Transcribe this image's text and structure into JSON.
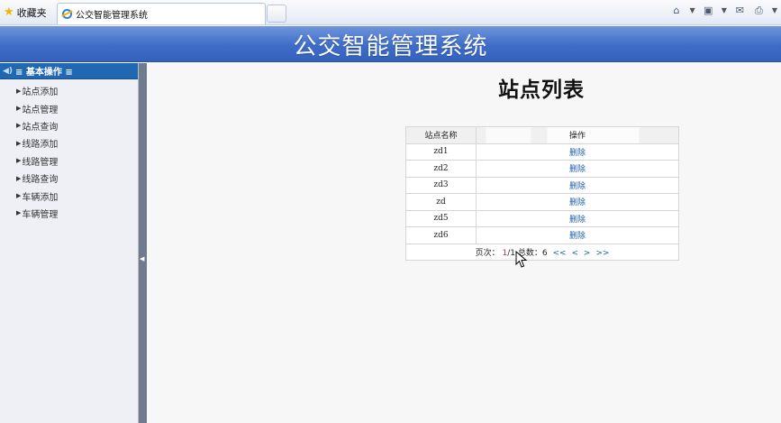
{
  "browser": {
    "favorites_label": "收藏夹",
    "tab_title": "公交智能管理系统"
  },
  "header": {
    "title": "公交智能管理系统"
  },
  "sidebar": {
    "section_title": "≡ 基本操作 ≡",
    "items": [
      {
        "label": "站点添加"
      },
      {
        "label": "站点管理"
      },
      {
        "label": "站点查询"
      },
      {
        "label": "线路添加"
      },
      {
        "label": "线路管理"
      },
      {
        "label": "线路查询"
      },
      {
        "label": "车辆添加"
      },
      {
        "label": "车辆管理"
      }
    ]
  },
  "main": {
    "title": "站点列表",
    "table": {
      "headers": {
        "name": "站点名称",
        "action": "操作"
      },
      "rows": [
        {
          "name": "zd1",
          "action": "删除"
        },
        {
          "name": "zd2",
          "action": "删除"
        },
        {
          "name": "zd3",
          "action": "删除"
        },
        {
          "name": "zd",
          "action": "删除"
        },
        {
          "name": "zd5",
          "action": "删除"
        },
        {
          "name": "zd6",
          "action": "删除"
        }
      ]
    },
    "pager": {
      "page_label": "页次：",
      "current": "1",
      "sep": "/",
      "total_pages": "1",
      "total_label": "总数：",
      "total": "6",
      "first": "<<",
      "prev": "<",
      "next": ">",
      "last": ">>"
    }
  },
  "colors": {
    "banner": "#3e6cc7",
    "sidebar_header": "#2168b3",
    "link": "#1f5fa8",
    "current_page": "#c0392b"
  }
}
